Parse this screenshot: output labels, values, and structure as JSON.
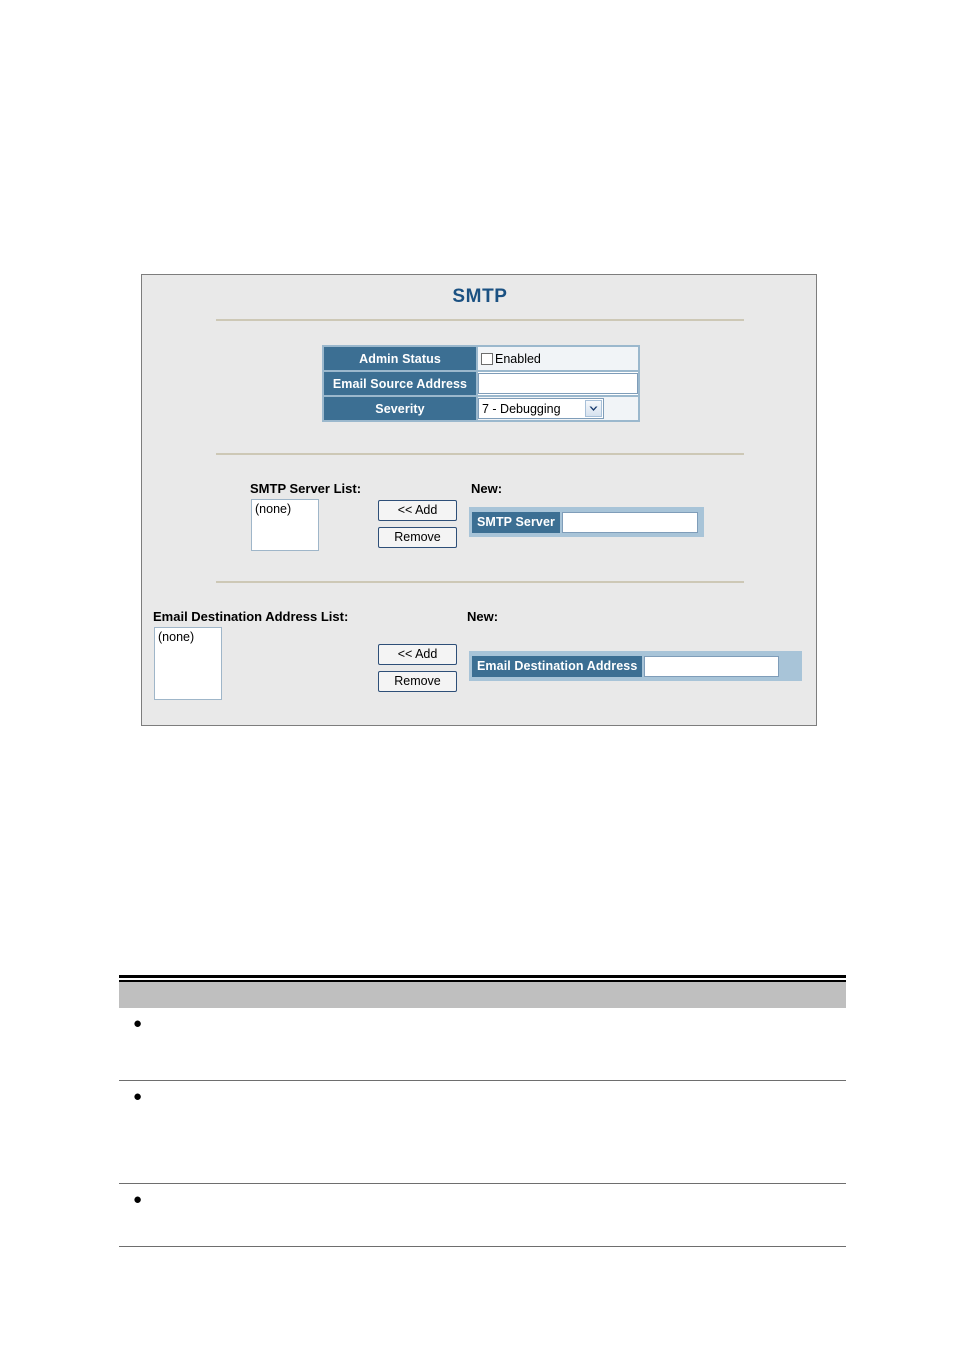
{
  "panel": {
    "title": "SMTP",
    "settings": {
      "rows": [
        {
          "label": "Admin Status",
          "type": "checkbox",
          "checkbox_label": "Enabled",
          "checked": false
        },
        {
          "label": "Email Source Address",
          "type": "text",
          "value": "",
          "placeholder": ""
        },
        {
          "label": "Severity",
          "type": "select",
          "value": "7 - Debugging"
        }
      ]
    },
    "server_section": {
      "list_label": "SMTP Server List:",
      "list_items": "(none)",
      "new_label": "New:",
      "add_button": "<< Add",
      "remove_button": "Remove",
      "field_label": "SMTP Server",
      "field_value": "",
      "field_placeholder": ""
    },
    "dest_section": {
      "list_label": "Email Destination Address List:",
      "list_items": "(none)",
      "new_label": "New:",
      "add_button": "<< Add",
      "remove_button": "Remove",
      "field_label": "Email Destination Address",
      "field_value": "",
      "field_placeholder": ""
    },
    "colors": {
      "title_blue": "#1b5182",
      "label_blue": "#3c6f93",
      "frame_blue": "#a8c4d8",
      "panel_bg": "#e9e9e9",
      "panel_border": "#7d7d7d",
      "separator": "#cdc8b6"
    }
  },
  "doc_table": {
    "header_text": "",
    "header_bg": "#bfbfbf",
    "rows": [
      {
        "bullet": "●",
        "text": ""
      },
      {
        "bullet": "●",
        "text": ""
      },
      {
        "bullet": "●",
        "text": ""
      }
    ]
  }
}
